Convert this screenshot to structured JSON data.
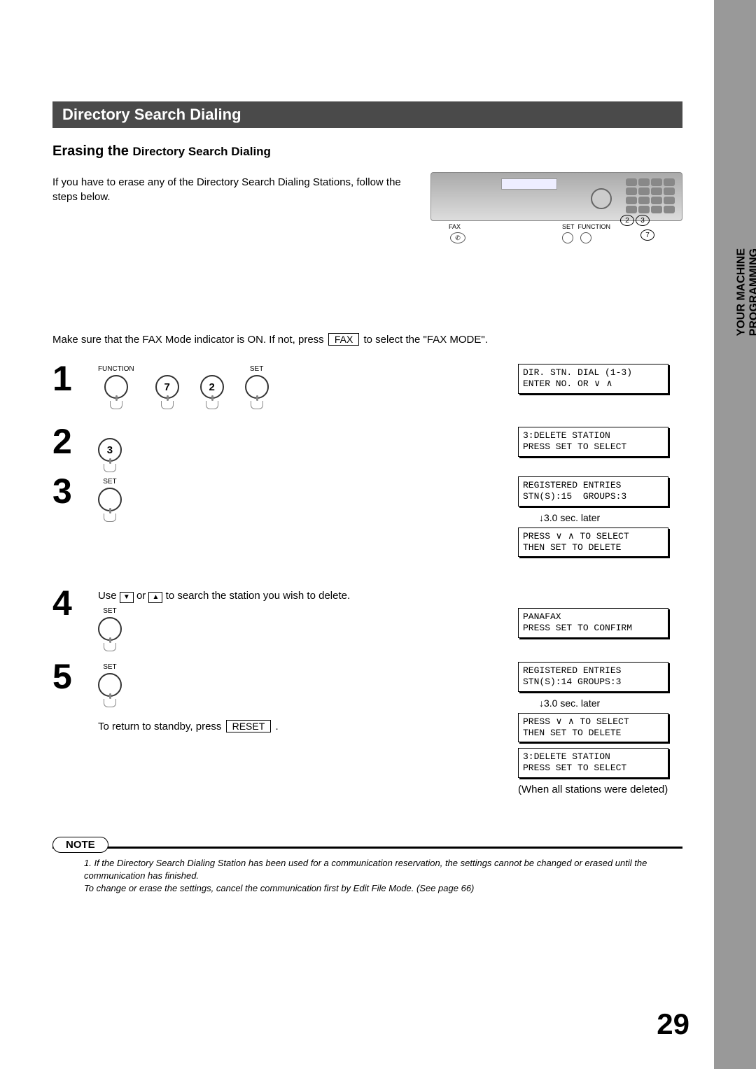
{
  "sidebar": {
    "line1": "PROGRAMMING",
    "line2": "YOUR MACHINE"
  },
  "banner": "Directory Search Dialing",
  "subtitle_bold": "Erasing the ",
  "subtitle_sub": "Directory Search Dialing",
  "intro": "If you have to erase any of the Directory Search Dialing Stations, follow the steps below.",
  "panel_labels": {
    "fax": "FAX",
    "set": "SET",
    "function": "FUNCTION",
    "k2": "2",
    "k3": "3",
    "k7": "7",
    "fax_glyph": "✆"
  },
  "pre_note_a": "Make sure that the FAX Mode indicator is ON.  If not, press ",
  "pre_note_key": "FAX",
  "pre_note_b": " to select the \"FAX MODE\".",
  "steps": {
    "s1": {
      "num": "1",
      "labels": {
        "function": "FUNCTION",
        "set": "SET"
      },
      "keys": {
        "k7": "7",
        "k2": "2"
      },
      "lcd": "DIR. STN. DIAL (1-3)\nENTER NO. OR ∨ ∧"
    },
    "s2": {
      "num": "2",
      "key": "3",
      "lcd": "3:DELETE STATION\nPRESS SET TO SELECT"
    },
    "s3": {
      "num": "3",
      "label": "SET",
      "lcd1": "REGISTERED ENTRIES\nSTN(S):15  GROUPS:3",
      "later": "↓3.0 sec. later",
      "lcd2": "PRESS ∨ ∧ TO SELECT\nTHEN SET TO DELETE"
    },
    "s4": {
      "num": "4",
      "text_a": "Use ",
      "text_b": " or ",
      "text_c": " to search the station you wish to delete.",
      "label": "SET",
      "down": "▼",
      "up": "▲",
      "lcd": "PANAFAX\nPRESS SET TO CONFIRM"
    },
    "s5": {
      "num": "5",
      "label": "SET",
      "lcd1": "REGISTERED ENTRIES\nSTN(S):14 GROUPS:3",
      "later": "↓3.0 sec. later",
      "lcd2": "PRESS ∨ ∧ TO SELECT\nTHEN SET TO DELETE",
      "lcd3": "3:DELETE STATION\nPRESS SET TO SELECT",
      "when": "(When all stations were deleted)",
      "return_a": "To return to standby, press ",
      "return_key": "RESET",
      "return_b": " ."
    }
  },
  "note": {
    "label": "NOTE",
    "marker": "1.",
    "line1": "If the Directory Search Dialing Station has been used for a communication reservation, the settings cannot be changed or erased until the communication has finished.",
    "line2": "To change or erase the settings, cancel the communication first by Edit File Mode.  (See page 66)"
  },
  "page_number": "29"
}
